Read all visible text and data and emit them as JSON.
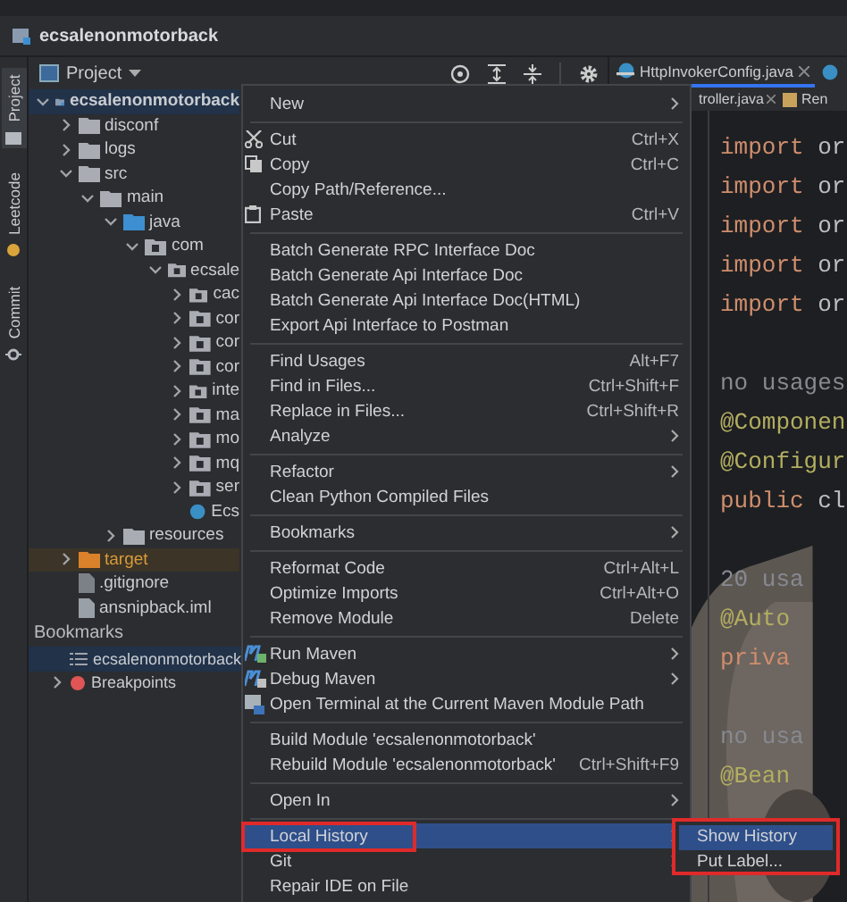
{
  "nav_bar": {
    "project_name": "ecsalenonmotorback"
  },
  "tool_strip": [
    {
      "label": "Project",
      "selected": true
    },
    {
      "label": "Leetcode",
      "selected": false
    },
    {
      "label": "Commit",
      "selected": false
    }
  ],
  "project_panel": {
    "title": "Project",
    "tree": [
      {
        "label": "ecsalenonmotorback",
        "kind": "module",
        "expanded": true,
        "selected": true,
        "children": [
          {
            "label": "disconf",
            "kind": "folder",
            "expanded": false,
            "selected": false
          },
          {
            "label": "logs",
            "kind": "folder",
            "expanded": false,
            "selected": false
          },
          {
            "label": "src",
            "kind": "folder",
            "expanded": true,
            "selected": false,
            "children": [
              {
                "label": "main",
                "kind": "folder",
                "expanded": true,
                "selected": false,
                "children": [
                  {
                    "label": "java",
                    "kind": "source",
                    "expanded": true,
                    "selected": false,
                    "children": [
                      {
                        "label": "com",
                        "kind": "package",
                        "expanded": true,
                        "selected": false,
                        "children": [
                          {
                            "label": "ecsale",
                            "kind": "package",
                            "expanded": true,
                            "selected": false,
                            "children": [
                              {
                                "label": "cac",
                                "kind": "package",
                                "expanded": false,
                                "selected": false
                              },
                              {
                                "label": "cor",
                                "kind": "package",
                                "expanded": false,
                                "selected": false
                              },
                              {
                                "label": "cor",
                                "kind": "package",
                                "expanded": false,
                                "selected": false
                              },
                              {
                                "label": "cor",
                                "kind": "package",
                                "expanded": false,
                                "selected": false
                              },
                              {
                                "label": "inte",
                                "kind": "package",
                                "expanded": false,
                                "selected": false
                              },
                              {
                                "label": "ma",
                                "kind": "package",
                                "expanded": false,
                                "selected": false
                              },
                              {
                                "label": "mo",
                                "kind": "package",
                                "expanded": false,
                                "selected": false
                              },
                              {
                                "label": "mq",
                                "kind": "package",
                                "expanded": false,
                                "selected": false
                              },
                              {
                                "label": "ser",
                                "kind": "package",
                                "expanded": false,
                                "selected": false
                              },
                              {
                                "label": "Ecs",
                                "kind": "class",
                                "selected": false
                              }
                            ]
                          }
                        ]
                      }
                    ]
                  },
                  {
                    "label": "resources",
                    "kind": "resources",
                    "expanded": false,
                    "selected": false
                  }
                ]
              }
            ]
          },
          {
            "label": "target",
            "kind": "excluded",
            "expanded": false,
            "selected": false
          },
          {
            "label": ".gitignore",
            "kind": "gitignore",
            "selected": false
          },
          {
            "label": "ansnipback.iml",
            "kind": "iml",
            "selected": false
          }
        ]
      }
    ],
    "bookmarks": {
      "title": "Bookmarks",
      "items": [
        {
          "label": "ecsalenonmotorback",
          "kind": "list",
          "selected": true
        },
        {
          "label": "Breakpoints",
          "kind": "breakpoints",
          "selected": false
        }
      ]
    }
  },
  "editor": {
    "tabs": [
      {
        "label": "HttpInvokerConfig.java",
        "selected": true
      }
    ],
    "tabs_row_2": [
      {
        "label": "troller.java",
        "kind": "class"
      },
      {
        "label": "Ren",
        "kind": "other"
      }
    ],
    "lines": [
      {
        "kind": "keyword",
        "keyword": "import",
        "rest": "or"
      },
      {
        "kind": "keyword",
        "keyword": "import",
        "rest": "or"
      },
      {
        "kind": "keyword",
        "keyword": "import",
        "rest": "or"
      },
      {
        "kind": "keyword",
        "keyword": "import",
        "rest": "or"
      },
      {
        "kind": "keyword",
        "keyword": "import",
        "rest": "or"
      },
      {
        "kind": "blank"
      },
      {
        "kind": "hint",
        "text": "no usages"
      },
      {
        "kind": "annotation",
        "text": "@Componen"
      },
      {
        "kind": "annotation",
        "text": "@Configur"
      },
      {
        "kind": "keyword",
        "keyword": "public",
        "rest": "cl"
      },
      {
        "kind": "blank"
      },
      {
        "kind": "hint",
        "text": "20 usa"
      },
      {
        "kind": "annotation",
        "text": "@Auto"
      },
      {
        "kind": "keyword",
        "keyword": "priva"
      },
      {
        "kind": "blank"
      },
      {
        "kind": "hint",
        "text": "no usa"
      },
      {
        "kind": "annotation",
        "text": "@Bean"
      }
    ]
  },
  "context_menu": [
    {
      "kind": "item",
      "label": "New",
      "submenu": true,
      "selected": false
    },
    {
      "kind": "separator"
    },
    {
      "kind": "item",
      "label": "Cut",
      "shortcut": "Ctrl+X",
      "selected": false
    },
    {
      "kind": "item",
      "label": "Copy",
      "shortcut": "Ctrl+C",
      "selected": false
    },
    {
      "kind": "item",
      "label": "Copy Path/Reference...",
      "selected": false
    },
    {
      "kind": "item",
      "label": "Paste",
      "shortcut": "Ctrl+V",
      "selected": false
    },
    {
      "kind": "separator"
    },
    {
      "kind": "item",
      "label": "Batch Generate RPC Interface Doc",
      "selected": false
    },
    {
      "kind": "item",
      "label": "Batch Generate Api Interface Doc",
      "selected": false
    },
    {
      "kind": "item",
      "label": "Batch Generate Api Interface Doc(HTML)",
      "selected": false
    },
    {
      "kind": "item",
      "label": "Export Api Interface to Postman",
      "selected": false
    },
    {
      "kind": "separator"
    },
    {
      "kind": "item",
      "label": "Find Usages",
      "shortcut": "Alt+F7",
      "selected": false
    },
    {
      "kind": "item",
      "label": "Find in Files...",
      "shortcut": "Ctrl+Shift+F",
      "selected": false
    },
    {
      "kind": "item",
      "label": "Replace in Files...",
      "shortcut": "Ctrl+Shift+R",
      "selected": false
    },
    {
      "kind": "item",
      "label": "Analyze",
      "submenu": true,
      "selected": false
    },
    {
      "kind": "separator"
    },
    {
      "kind": "item",
      "label": "Refactor",
      "submenu": true,
      "selected": false
    },
    {
      "kind": "item",
      "label": "Clean Python Compiled Files",
      "selected": false
    },
    {
      "kind": "separator"
    },
    {
      "kind": "item",
      "label": "Bookmarks",
      "submenu": true,
      "selected": false
    },
    {
      "kind": "separator"
    },
    {
      "kind": "item",
      "label": "Reformat Code",
      "shortcut": "Ctrl+Alt+L",
      "selected": false
    },
    {
      "kind": "item",
      "label": "Optimize Imports",
      "shortcut": "Ctrl+Alt+O",
      "selected": false
    },
    {
      "kind": "item",
      "label": "Remove Module",
      "shortcut": "Delete",
      "selected": false
    },
    {
      "kind": "separator"
    },
    {
      "kind": "item",
      "label": "Run Maven",
      "submenu": true,
      "selected": false
    },
    {
      "kind": "item",
      "label": "Debug Maven",
      "submenu": true,
      "selected": false
    },
    {
      "kind": "item",
      "label": "Open Terminal at the Current Maven Module Path",
      "selected": false
    },
    {
      "kind": "separator"
    },
    {
      "kind": "item",
      "label": "Build Module 'ecsalenonmotorback'",
      "selected": false
    },
    {
      "kind": "item",
      "label": "Rebuild Module 'ecsalenonmotorback'",
      "shortcut": "Ctrl+Shift+F9",
      "selected": false
    },
    {
      "kind": "separator"
    },
    {
      "kind": "item",
      "label": "Open In",
      "submenu": true,
      "selected": false
    },
    {
      "kind": "separator"
    },
    {
      "kind": "item",
      "label": "Local History",
      "submenu": true,
      "selected": true,
      "highlighted": true
    },
    {
      "kind": "item",
      "label": "Git",
      "submenu": true,
      "selected": false
    },
    {
      "kind": "item",
      "label": "Repair IDE on File",
      "selected": false
    }
  ],
  "submenu": {
    "highlighted": true,
    "items": [
      {
        "label": "Show History",
        "selected": true
      },
      {
        "label": "Put Label...",
        "selected": false
      }
    ]
  }
}
